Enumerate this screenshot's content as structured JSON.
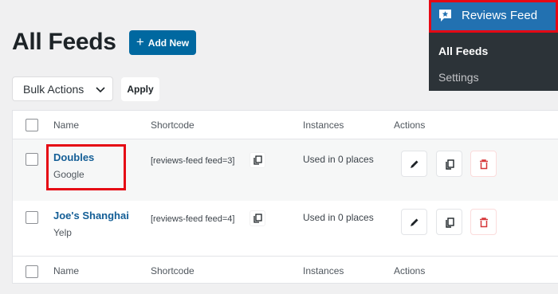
{
  "page": {
    "title": "All Feeds",
    "add_new_label": "Add New"
  },
  "toolbar": {
    "bulk_actions_label": "Bulk Actions",
    "apply_label": "Apply"
  },
  "table": {
    "columns": [
      "Name",
      "Shortcode",
      "Instances",
      "Actions"
    ],
    "rows": [
      {
        "name": "Doubles",
        "source": "Google",
        "shortcode": "[reviews-feed feed=3]",
        "instances": "Used in 0 places"
      },
      {
        "name": "Joe's Shanghai",
        "source": "Yelp",
        "shortcode": "[reviews-feed feed=4]",
        "instances": "Used in 0 places"
      }
    ]
  },
  "menu": {
    "title": "Reviews Feed",
    "title_icon": "review-star-icon",
    "items": [
      {
        "label": "All Feeds",
        "active": true
      },
      {
        "label": "Settings",
        "active": false
      }
    ]
  },
  "colors": {
    "primary": "#0068a0",
    "link": "#135e96",
    "menu_bg": "#2c3338",
    "menu_active": "#2271b1",
    "highlight": "#e50914",
    "delete": "#d63638"
  }
}
